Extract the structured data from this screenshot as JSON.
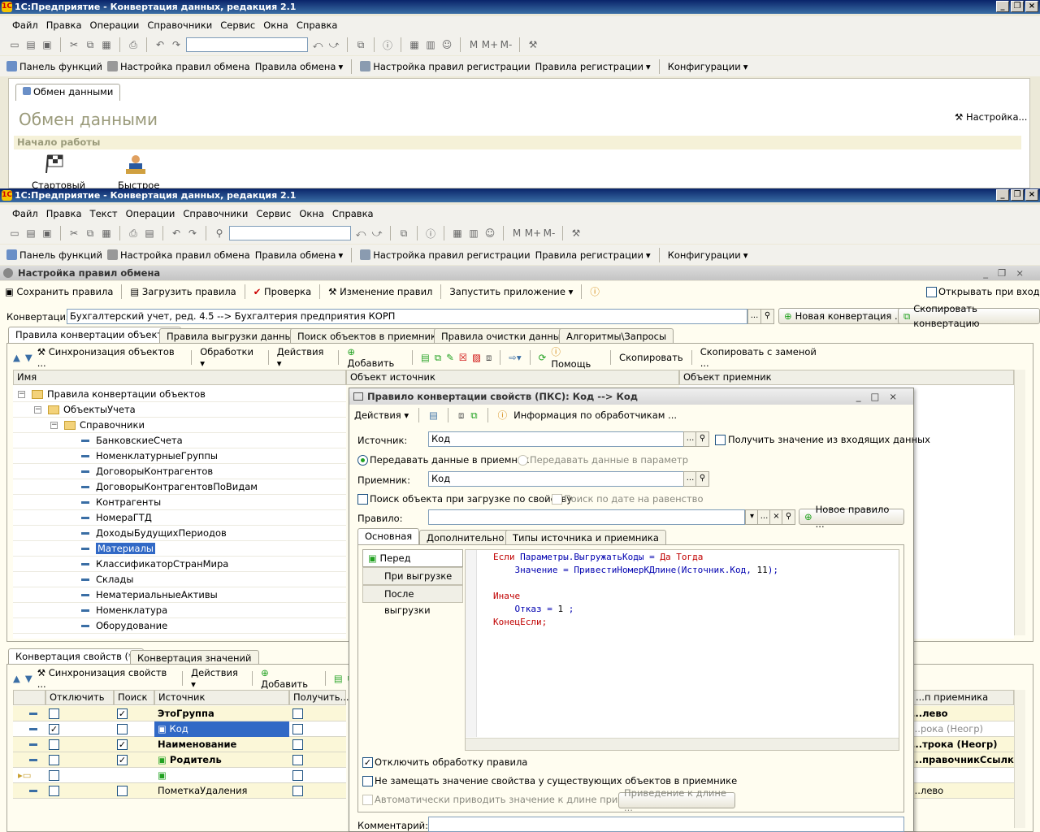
{
  "app_title": "1С:Предприятие - Конвертация данных, редакция 2.1",
  "menu1": [
    "Файл",
    "Правка",
    "Операции",
    "Справочники",
    "Сервис",
    "Окна",
    "Справка"
  ],
  "menu2": [
    "Файл",
    "Правка",
    "Текст",
    "Операции",
    "Справочники",
    "Сервис",
    "Окна",
    "Справка"
  ],
  "funcbar": {
    "panel": "Панель функций",
    "exch_settings": "Настройка правил обмена",
    "exch_rules": "Правила обмена",
    "reg_settings": "Настройка правил регистрации",
    "reg_rules": "Правила регистрации",
    "configs": "Конфигурации"
  },
  "bg": {
    "tab": "Обмен данными",
    "title": "Обмен данными",
    "settings": "Настройка...",
    "section": "Начало работы",
    "item1": "Стартовый",
    "item2": "Быстрое"
  },
  "win": {
    "title": "Настройка правил обмена",
    "save": "Сохранить правила",
    "load": "Загрузить правила",
    "check": "Проверка",
    "change": "Изменение правил",
    "run": "Запустить приложение",
    "open_on_enter": "Открывать при входе",
    "conv_label": "Конвертация:",
    "conv_value": "Бухгалтерский учет, ред. 4.5 --> Бухгалтерия предприятия КОРП",
    "new_conv": "Новая конвертация ...",
    "copy_conv": "Скопировать конвертацию",
    "tabs": [
      "Правила конвертации объектов",
      "Правила выгрузки данных",
      "Поиск объектов в приемнике",
      "Правила очистки данных",
      "Алгоритмы\\Запросы"
    ],
    "tb": {
      "sync": "Синхронизация объектов ...",
      "handlers": "Обработки",
      "actions": "Действия",
      "add": "Добавить",
      "help": "Помощь",
      "copy": "Скопировать",
      "copy_replace": "Скопировать с заменой ..."
    },
    "cols": {
      "name": "Имя",
      "source": "Объект источник",
      "target": "Объект приемник"
    },
    "tree": {
      "root": "Правила конвертации объектов",
      "l1": "ОбъектыУчета",
      "l2": "Справочники",
      "items": [
        "БанковскиеСчета",
        "НоменклатурныеГруппы",
        "ДоговорыКонтрагентов",
        "ДоговорыКонтрагентовПоВидам",
        "Контрагенты",
        "НомераГТД",
        "ДоходыБудущихПериодов",
        "Материалы",
        "КлассификаторСтранМира",
        "Склады",
        "НематериальныеАктивы",
        "Номенклатура",
        "Оборудование"
      ]
    },
    "btabs": [
      "Конвертация свойств (*)",
      "Конвертация значений"
    ],
    "btb": {
      "sync": "Синхронизация свойств ...",
      "actions": "Действия",
      "add": "Добавить"
    },
    "gcols": {
      "disable": "Отключить",
      "search": "Поиск",
      "source": "Источник",
      "get": "Получить...",
      "target": "...п приемника"
    },
    "grid": [
      {
        "name": "ЭтоГруппа",
        "bold": true,
        "dis": false,
        "srch": true,
        "tgt": "...лево"
      },
      {
        "name": "Код",
        "bold": false,
        "dis": true,
        "srch": false,
        "tgt": "...рока (Неогр)"
      },
      {
        "name": "Наименование",
        "bold": true,
        "dis": false,
        "srch": true,
        "tgt": "...трока (Неогр)"
      },
      {
        "name": "Родитель",
        "bold": true,
        "dis": false,
        "srch": true,
        "tgt": "...правочникСсылка..."
      },
      {
        "name": "",
        "bold": false,
        "dis": false,
        "srch": false,
        "tgt": ""
      },
      {
        "name": "ПометкаУдаления",
        "bold": false,
        "dis": false,
        "srch": false,
        "tgt": "...лево"
      }
    ]
  },
  "dlg": {
    "title": "Правило конвертации свойств (ПКС): Код --> Код",
    "actions": "Действия",
    "handler_info": "Информация по обработчикам ...",
    "src_label": "Источник:",
    "src_value": "Код",
    "get_incoming": "Получить значение из входящих данных",
    "pass_target": "Передавать данные в приемник",
    "pass_param": "Передавать данные в параметр",
    "tgt_label": "Приемник:",
    "tgt_value": "Код",
    "search_prop": "Поиск объекта при загрузке по свойству",
    "search_date": "Поиск по дате на равенство",
    "rule_label": "Правило:",
    "new_rule": "Новое правило ...",
    "tabs": [
      "Основная",
      "Дополнительно",
      "Типы источника и приемника"
    ],
    "events": [
      "Перед выгрузкой",
      "При выгрузке",
      "После выгрузки"
    ],
    "disable_handling": "Отключить обработку правила",
    "no_replace": "Не замещать значение свойства у существующих объектов в приемнике",
    "auto_length": "Автоматически приводить значение к длине приемника",
    "to_length": "Приведение к длине ...",
    "comment": "Комментарий:"
  }
}
